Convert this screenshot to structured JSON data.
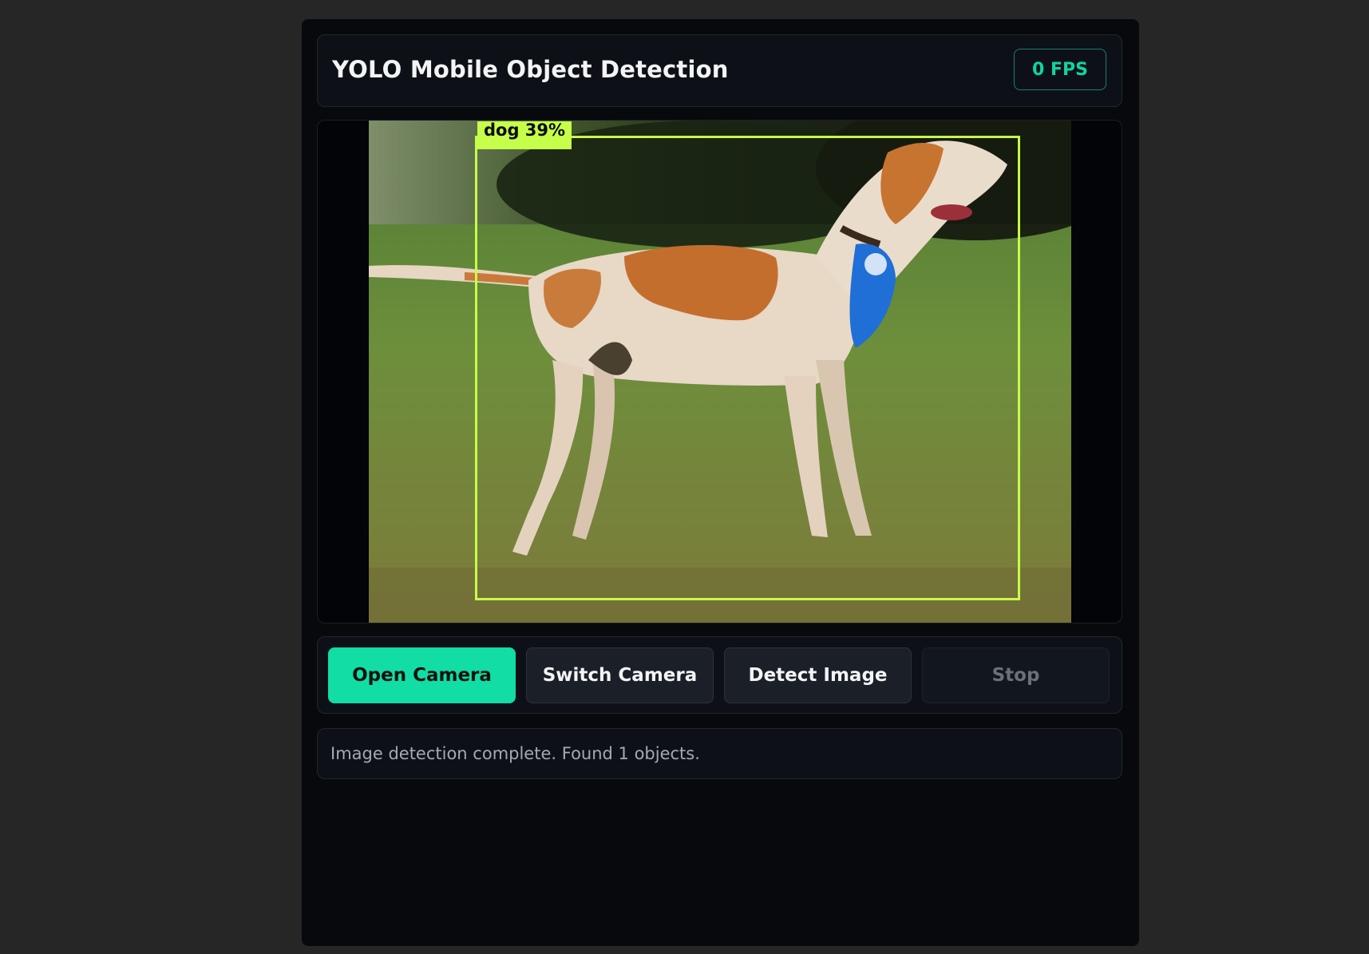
{
  "header": {
    "title": "YOLO Mobile Object Detection",
    "fps_label": "0 FPS"
  },
  "viewer": {
    "image_subject": "dog",
    "detections": [
      {
        "label": "dog 39%",
        "class": "dog",
        "confidence_percent": 39
      }
    ],
    "box_color": "#c6ff4a"
  },
  "controls": {
    "open_camera": "Open Camera",
    "switch_camera": "Switch Camera",
    "detect_image": "Detect Image",
    "stop": "Stop"
  },
  "status": {
    "message": "Image detection complete. Found 1 objects."
  },
  "colors": {
    "accent": "#12dda5",
    "fps_text": "#12d39f",
    "background": "#252625",
    "panel": "#0d1117"
  }
}
